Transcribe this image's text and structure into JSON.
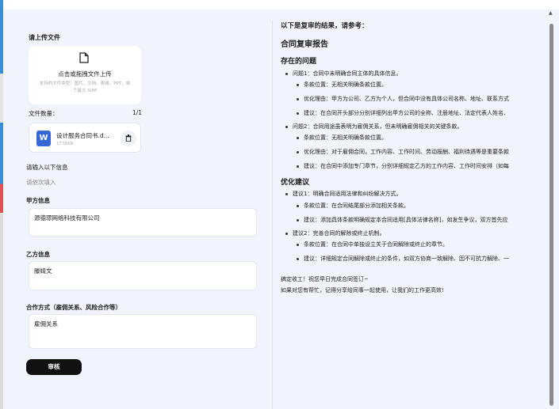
{
  "left": {
    "upload_section_label": "请上传文件",
    "upload_title": "点击或拖拽文件上传",
    "upload_hint": "支持的文件类型：图片、文档、表格、PPT，单个最大 50M",
    "file_count_label": "文件数量：",
    "file_count_value": "1/1",
    "file": {
      "name": "设计服务合同书.d...",
      "size": "17.56KB",
      "type_letter": "W"
    },
    "info_title": "请输入以下信息",
    "info_sub": "请依次填入",
    "party_a_label": "甲方信息",
    "party_a_value": "源德璟网络科技有限公司",
    "party_b_label": "乙方信息",
    "party_b_value": "滕婧文",
    "coop_label": "合作方式（雇佣关系、风险合作等）",
    "coop_value": "雇佣关系",
    "submit_label": "审核"
  },
  "right": {
    "intro": "以下是复审的结果，请参考：",
    "report_title": "合同复审报告",
    "issues_heading": "存在的问题",
    "issue1": "问题1：合同中未明确合同主体的具体信息。",
    "issue1_pos": "条款位置：无相关明确条款位置。",
    "issue1_reason": "优化理由：甲方为公司、乙方为个人，但合同中没有具体公司名称、地址、联系方式",
    "issue1_suggest": "建议：在合同开头部分分别详细列出甲方公司的全称、注册地址、法定代表人姓名、",
    "issue2": "问题2：合同用途虽表明为雇佣关系，但未明确雇佣相关的关键条款。",
    "issue2_pos": "条款位置：无相关明确条款位置。",
    "issue2_reason": "优化理由：对于雇佣合同，工作内容、工作时间、劳动报酬、福利待遇等是重要条款",
    "issue2_suggest": "建议：在合同中添加专门章节，分别详细规定乙方的工作内容、工作时间安排（如每",
    "opt_heading": "优化建议",
    "sug1": "建议1：明确合同适用法律和纠纷解决方式。",
    "sug1_pos": "条款位置：在合同结尾部分添加相关条款。",
    "sug1_detail": "建议：添加具体条款明确规定本合同适用[具体法律名称]，如发生争议，双方首先应",
    "sug2": "建议2：完善合同的解除或终止机制。",
    "sug2_pos": "条款位置：在合同中单独设立关于合同解除或终止的章节。",
    "sug2_detail": "建议：详细规定合同解除或终止的条件，如双方协商一致解除、因不可抗力解除、一",
    "closing1": "搞定收工！祝您早日完成合同签订~",
    "closing2": "如果对您有帮忙，记得分享给同事一起使用，让我们的工作更高效!"
  }
}
